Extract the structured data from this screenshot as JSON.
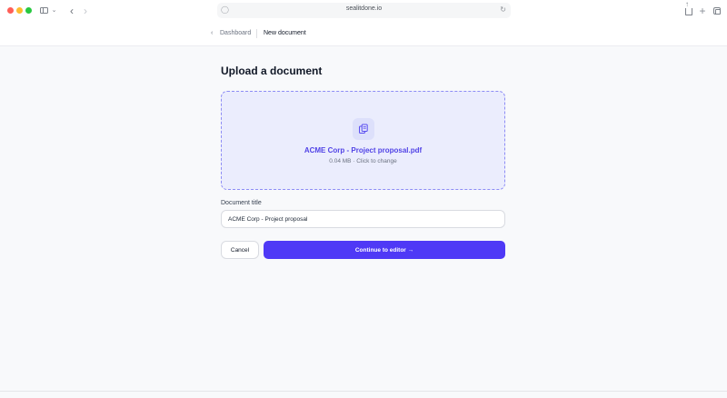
{
  "browser": {
    "url": "sealitdone.io",
    "icons": {
      "close": "traffic-light-red",
      "minimize": "traffic-light-yellow",
      "maximize": "traffic-light-green",
      "sidebar": "sidebar-icon",
      "back": "chevron-left-icon",
      "forward": "chevron-right-icon",
      "site": "shield-icon",
      "reload": "reload-icon",
      "share": "share-icon",
      "new_tab": "plus-icon",
      "tab_overview": "tabs-icon"
    }
  },
  "header": {
    "back_label": "Dashboard",
    "current_page": "New document"
  },
  "main": {
    "title": "Upload a document",
    "upload": {
      "file_name": "ACME Corp - Project proposal.pdf",
      "file_meta": "0.04 MB · Click to change",
      "icon": "copy-document-icon"
    },
    "document_title": {
      "label": "Document title",
      "value": "ACME Corp - Project proposal"
    },
    "actions": {
      "cancel_label": "Cancel",
      "continue_label": "Continue to editor →"
    }
  },
  "colors": {
    "accent": "#4f39f6",
    "dropzone_bg": "#ebedfd",
    "dropzone_border": "#8d8cf5",
    "file_name": "#5143e6",
    "page_bg": "#f8f9fb"
  }
}
